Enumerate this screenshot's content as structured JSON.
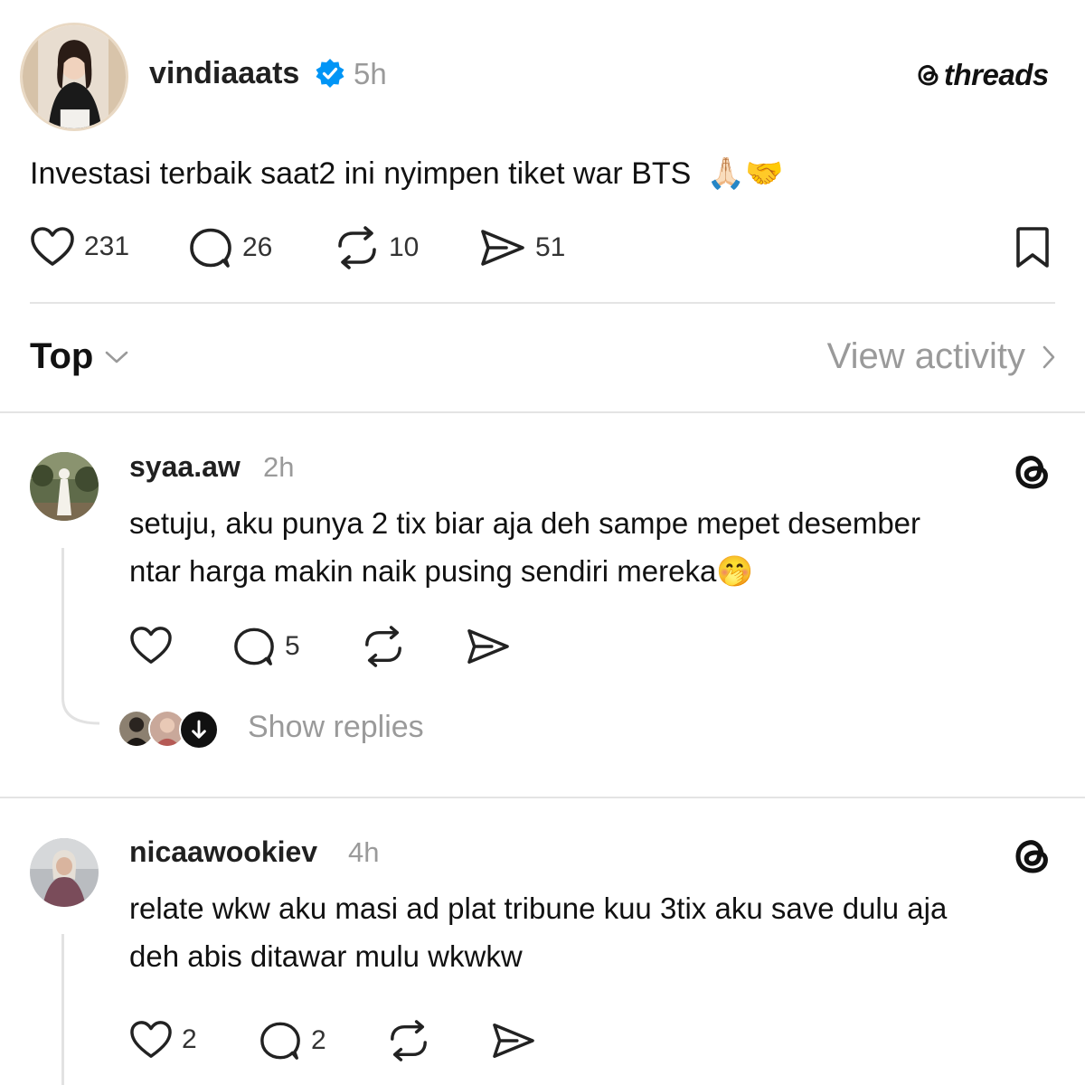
{
  "post": {
    "username": "vindiaaats",
    "time": "5h",
    "verified": true,
    "text": "Investasi terbaik saat2 ini nyimpen tiket war BTS",
    "text_emoji": "🙏🏻🤝",
    "brand": "threads",
    "likes": "231",
    "replies": "26",
    "reposts": "10",
    "shares": "51",
    "icons": [
      "heart-icon",
      "comment-icon",
      "repost-icon",
      "share-icon",
      "bookmark-icon"
    ]
  },
  "filter": {
    "sort_label": "Top",
    "view_activity_label": "View activity"
  },
  "comments": [
    {
      "username": "syaa.aw",
      "time": "2h",
      "line1": "setuju, aku punya 2 tix biar aja deh sampe mepet desember",
      "line2": "ntar harga makin naik pusing sendiri mereka",
      "line2_emoji": "🤭",
      "likes": "",
      "replies": "5",
      "show_replies_label": "Show replies"
    },
    {
      "username": "nicaawookiev",
      "time": "4h",
      "line1": "relate wkw aku masi ad plat tribune kuu 3tix aku save dulu aja",
      "line2": "deh abis ditawar mulu wkwkw",
      "likes": "2",
      "replies": "2"
    }
  ],
  "colors": {
    "verified_blue": "#0095f6",
    "muted_text": "#9a9a9a",
    "divider": "#e4e4e4"
  }
}
